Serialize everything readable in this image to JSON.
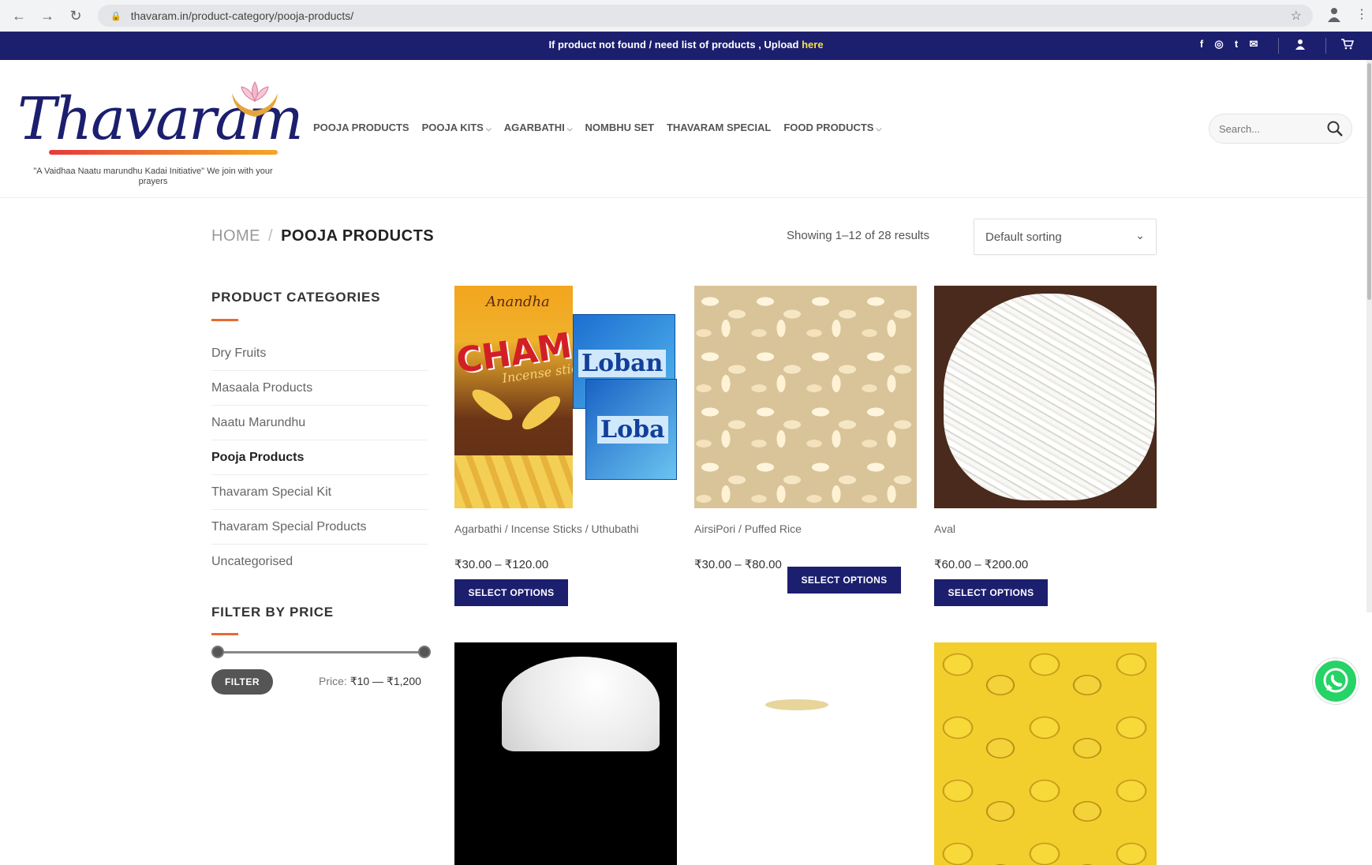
{
  "browser": {
    "url": "thavaram.in/product-category/pooja-products/"
  },
  "topbar": {
    "notice_text": "If product not found / need list of products , Upload",
    "notice_link": "here",
    "socials": [
      "f",
      "◎",
      "t",
      "✉"
    ]
  },
  "header": {
    "logo_text": "Thavaram",
    "tagline": "\"A Vaidhaa Naatu marundhu Kadai Initiative\" We join with your prayers",
    "nav": [
      {
        "label": "POOJA PRODUCTS",
        "has_caret": false
      },
      {
        "label": "POOJA KITS",
        "has_caret": true
      },
      {
        "label": "AGARBATHI",
        "has_caret": true
      },
      {
        "label": "NOMBHU SET",
        "has_caret": false
      },
      {
        "label": "THAVARAM SPECIAL",
        "has_caret": false
      },
      {
        "label": "FOOD PRODUCTS",
        "has_caret": true
      }
    ],
    "search_placeholder": "Search..."
  },
  "breadcrumb": {
    "home": "HOME",
    "separator": "/",
    "current": "POOJA PRODUCTS"
  },
  "results_text": "Showing 1–12 of 28 results",
  "sorting": {
    "selected": "Default sorting"
  },
  "sidebar": {
    "categories_title": "PRODUCT CATEGORIES",
    "categories": [
      {
        "label": "Dry Fruits",
        "active": false
      },
      {
        "label": "Masaala Products",
        "active": false
      },
      {
        "label": "Naatu Marundhu",
        "active": false
      },
      {
        "label": "Pooja Products",
        "active": true
      },
      {
        "label": "Thavaram Special Kit",
        "active": false
      },
      {
        "label": "Thavaram Special Products",
        "active": false
      },
      {
        "label": "Uncategorised",
        "active": false
      }
    ],
    "filter_title": "FILTER BY PRICE",
    "filter_button": "FILTER",
    "price_prefix": "Price:",
    "price_range": "₹10 — ₹1,200"
  },
  "products": [
    {
      "name": "Agarbathi / Incense Sticks / Uthubathi",
      "price": "₹30.00 – ₹120.00",
      "button": "SELECT OPTIONS"
    },
    {
      "name": "AirsiPori / Puffed Rice",
      "price": "₹30.00 – ₹80.00",
      "button": "SELECT OPTIONS"
    },
    {
      "name": "Aval",
      "price": "₹60.00 – ₹200.00",
      "button": "SELECT OPTIONS"
    }
  ],
  "product_art": {
    "champ_brand": "Anandha",
    "champ_title": "CHAMP",
    "champ_sub": "Incense sticks",
    "loban_label": "Loban",
    "loban_label_2": "Loba"
  },
  "colors": {
    "brand_navy": "#1c1f6e",
    "accent_orange": "#e86a33",
    "link_yellow": "#f4e04d",
    "whatsapp": "#25d366"
  }
}
